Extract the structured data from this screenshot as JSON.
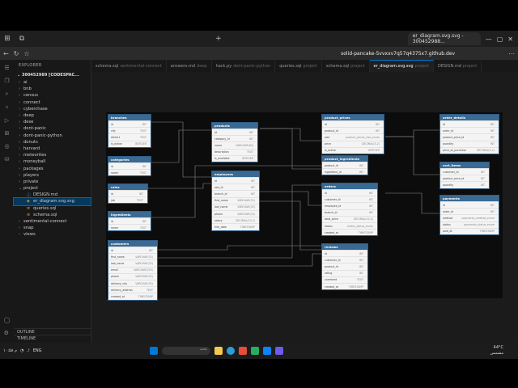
{
  "browser": {
    "active_tab": "er_diagram.svg.svg - 300452988...",
    "url": "solid-pancake-5vvxxv7q57q4375x7.github.dev"
  },
  "explorer": {
    "header": "EXPLORER",
    "root": "300452989 [CODESPAC...",
    "items": [
      {
        "label": "ai",
        "type": "folder"
      },
      {
        "label": "bnb",
        "type": "folder"
      },
      {
        "label": "census",
        "type": "folder"
      },
      {
        "label": "connect",
        "type": "folder"
      },
      {
        "label": "cyberchase",
        "type": "folder"
      },
      {
        "label": "deep",
        "type": "folder"
      },
      {
        "label": "dese",
        "type": "folder"
      },
      {
        "label": "dont-panic",
        "type": "folder"
      },
      {
        "label": "dont-panic-python",
        "type": "folder"
      },
      {
        "label": "donuts",
        "type": "folder"
      },
      {
        "label": "harvard",
        "type": "folder"
      },
      {
        "label": "meteorites",
        "type": "folder"
      },
      {
        "label": "moneyball",
        "type": "folder"
      },
      {
        "label": "packages",
        "type": "folder"
      },
      {
        "label": "players",
        "type": "folder"
      },
      {
        "label": "private",
        "type": "folder"
      },
      {
        "label": "project",
        "type": "folder-open"
      },
      {
        "label": "DESIGN.md",
        "type": "child"
      },
      {
        "label": "er_diagram.svg.svg",
        "type": "child-selected"
      },
      {
        "label": "queries.sql",
        "type": "child"
      },
      {
        "label": "schema.sql",
        "type": "child"
      },
      {
        "label": "sentimental-connect",
        "type": "folder"
      },
      {
        "label": "snap",
        "type": "folder"
      },
      {
        "label": "views",
        "type": "folder"
      }
    ],
    "outline": "OUTLINE",
    "timeline": "TIMELINE"
  },
  "editor_tabs": [
    {
      "label": "schema.sql",
      "dim": "sentimental-connect"
    },
    {
      "label": "answers.md",
      "dim": "deep"
    },
    {
      "label": "hack.py",
      "dim": "dont-panic-python"
    },
    {
      "label": "queries.sql",
      "dim": "project"
    },
    {
      "label": "schema.sql",
      "dim": "project"
    },
    {
      "label": "er_diagram.svg.svg",
      "dim": "project",
      "active": true
    },
    {
      "label": "DESIGN.md",
      "dim": "project"
    }
  ],
  "tables": {
    "branches": {
      "title": "branches",
      "rows": [
        [
          "id",
          "INT"
        ],
        [
          "city",
          "TEXT"
        ],
        [
          "district",
          "TEXT"
        ],
        [
          "is_active",
          "INTEGER"
        ]
      ]
    },
    "categories": {
      "title": "categories",
      "rows": [
        [
          "id",
          "INT"
        ],
        [
          "name",
          "TEXT"
        ]
      ]
    },
    "roles": {
      "title": "roles",
      "rows": [
        [
          "id",
          "INT"
        ],
        [
          "job",
          "TEXT"
        ]
      ]
    },
    "ingredients": {
      "title": "ingredients",
      "rows": [
        [
          "id",
          "INT"
        ],
        [
          "name",
          "TEXT"
        ]
      ]
    },
    "customers": {
      "title": "customers",
      "rows": [
        [
          "id",
          "INT"
        ],
        [
          "first_name",
          "VARCHAR(32)"
        ],
        [
          "last_name",
          "VARCHAR(32)"
        ],
        [
          "email",
          "VARCHAR(255)"
        ],
        [
          "phone",
          "VARCHAR(32)"
        ],
        [
          "delivery_city",
          "VARCHAR(32)"
        ],
        [
          "delivery_address",
          "TEXT"
        ],
        [
          "created_at",
          "TIMESTAMP"
        ]
      ]
    },
    "products": {
      "title": "products",
      "rows": [
        [
          "id",
          "INT"
        ],
        [
          "category_id",
          "INT"
        ],
        [
          "name",
          "VARCHAR(64)"
        ],
        [
          "description",
          "TEXT"
        ],
        [
          "is_available",
          "INTEGER"
        ]
      ]
    },
    "employees": {
      "title": "employees",
      "rows": [
        [
          "id",
          "INT"
        ],
        [
          "role_id",
          "INT"
        ],
        [
          "branch_id",
          "INT"
        ],
        [
          "first_name",
          "VARCHAR(32)"
        ],
        [
          "last_name",
          "VARCHAR(32)"
        ],
        [
          "phone",
          "VARCHAR(32)"
        ],
        [
          "salary",
          "DECIMAL(10,2)"
        ],
        [
          "hire_date",
          "TIMESTAMP"
        ]
      ]
    },
    "product_prices": {
      "title": "product_prices",
      "rows": [
        [
          "id",
          "INT"
        ],
        [
          "product_id",
          "INT"
        ],
        [
          "size",
          "product_prices_size_enum"
        ],
        [
          "price",
          "DECIMAL(5,2)"
        ],
        [
          "is_active",
          "INTEGER"
        ]
      ]
    },
    "product_ingredients": {
      "title": "product_ingredients",
      "rows": [
        [
          "product_id",
          "INT"
        ],
        [
          "ingredient_id",
          "INT"
        ]
      ]
    },
    "orders": {
      "title": "orders",
      "rows": [
        [
          "id",
          "INT"
        ],
        [
          "customer_id",
          "INT"
        ],
        [
          "employee_id",
          "INT"
        ],
        [
          "branch_id",
          "INT"
        ],
        [
          "total_price",
          "DECIMAL(10,2)"
        ],
        [
          "status",
          "orders_status_enum"
        ],
        [
          "created_at",
          "TIMESTAMP"
        ]
      ]
    },
    "reviews": {
      "title": "reviews",
      "rows": [
        [
          "id",
          "INT"
        ],
        [
          "customer_id",
          "INT"
        ],
        [
          "product_id",
          "INT"
        ],
        [
          "rating",
          "INT"
        ],
        [
          "comment",
          "TEXT"
        ],
        [
          "created_at",
          "TIMESTAMP"
        ]
      ]
    },
    "order_details": {
      "title": "order_details",
      "rows": [
        [
          "id",
          "INT"
        ],
        [
          "order_id",
          "INT"
        ],
        [
          "product_price_id",
          "INT"
        ],
        [
          "quantity",
          "INT"
        ],
        [
          "price_at_purchase",
          "DECIMAL(5,2)"
        ]
      ]
    },
    "cart_items": {
      "title": "cart_items",
      "rows": [
        [
          "customer_id",
          "INT"
        ],
        [
          "product_price_id",
          "INT"
        ],
        [
          "quantity",
          "INT"
        ]
      ]
    },
    "payments": {
      "title": "payments",
      "rows": [
        [
          "id",
          "INT"
        ],
        [
          "order_id",
          "INT"
        ],
        [
          "method",
          "payments_method_enum"
        ],
        [
          "status",
          "payments_status_enum"
        ],
        [
          "paid_at",
          "TIMESTAMP"
        ]
      ]
    }
  },
  "taskbar": {
    "weather": "°C",
    "lang": "ENG",
    "time": "۱۰:۵۸ م",
    "date": "۲۰۲۴/۰۸/۰۷",
    "search": "بحث",
    "temp": "44°C",
    "temp_sub": "مشمس"
  }
}
